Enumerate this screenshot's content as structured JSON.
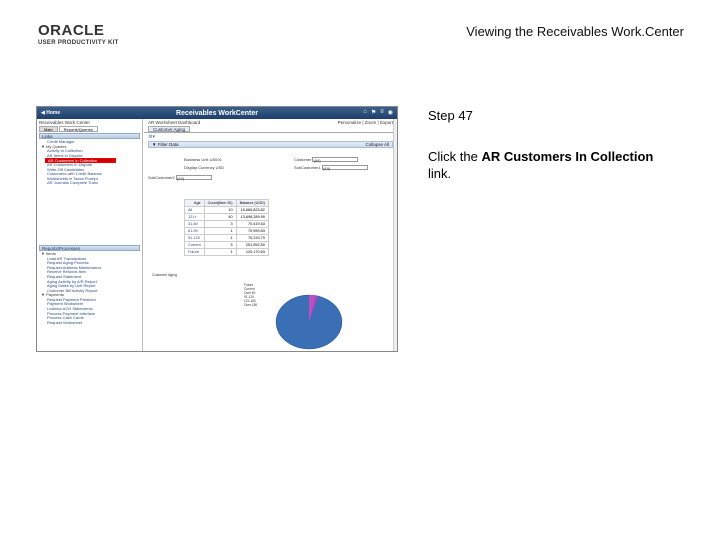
{
  "logo": {
    "brand": "ORACLE",
    "tagline": "USER PRODUCTIVITY KIT"
  },
  "page_title": "Viewing the Receivables Work.Center",
  "step": {
    "title": "Step 47",
    "prefix": "Click the ",
    "link": "AR Customers In Collection",
    "suffix": " link."
  },
  "app": {
    "home": "Home",
    "title": "Receivables WorkCenter",
    "left_header": "Receivables Work Center",
    "tabs": [
      "Main",
      "Reports/Queries"
    ],
    "links_section": "Links",
    "links_items": [
      "Credit Manager"
    ],
    "my_queries_group": "My Queries",
    "my_queries": [
      "Activity in Collection",
      "AR Items In Dispute",
      "AR Customers In Collection",
      "AR Customers In Dispute",
      "Write-Off Candidates",
      "Customers with Credit Balance",
      "Worksheets in Taxes Prompt",
      "AR Journals Complete Trans"
    ],
    "reports_section": "Reports/Processes",
    "reports_group": "Items",
    "reports": [
      "Load AR Transactions",
      "Request Aging Process",
      "Request Address Maintenance",
      "Receive Refunds Item",
      "Request Statement",
      "Aging Activity by A/R Report",
      "Aging Dates by Unit Report",
      "Customer Bill Activity Report"
    ],
    "payments_group": "Payments",
    "payments": [
      "Request Payment Predictor",
      "Payment Worksheet",
      "Lockbox ACH Statements",
      "Process Payment Interface",
      "Process Cash Cards",
      "Request Worksheet"
    ],
    "right_header": "AR Worksheet Dashboard",
    "right_header_right": "Personalize | Zoom | Export",
    "right_tab": "Customer Aging",
    "filters_label": "Filter Data",
    "collapse_all": "Collapse All",
    "business_unit_label": "Business Unit",
    "business_unit": "US001",
    "display_currency_label": "Display Currency",
    "display_currency": "USD",
    "customer_label": "Customer",
    "customer": "(All)",
    "sub_customer_label": "SubCustomer1",
    "sub_customer": "(All)",
    "sub_customer2_label": "SubCustomer2",
    "sub_customer2": "(All)",
    "chart_title": "Customer Aging",
    "legend": [
      "Future",
      "Current",
      "Over 60",
      "91-120",
      "121-180",
      "Over 180"
    ]
  },
  "colors": {
    "header": "#1e3f6a",
    "highlight": "#cc0000",
    "pie_main": "#3a6eb5",
    "pie_slice": "#c04fc0"
  },
  "chart_data": {
    "type": "table",
    "columns": [
      "Age",
      "Count(Item ID)",
      "Balance (USD)"
    ],
    "rows": [
      [
        "All",
        "10",
        "16,666,823.82"
      ],
      [
        "121+",
        "40",
        "13,698,289.99"
      ],
      [
        "31-60",
        "3",
        "70,419.63"
      ],
      [
        "61-90",
        "1",
        "70,959.83"
      ],
      [
        "91-120",
        "1",
        "75,233.79"
      ],
      [
        "Current",
        "5",
        "251,952.50"
      ],
      [
        "Future",
        "1",
        "120,170.63"
      ]
    ]
  }
}
